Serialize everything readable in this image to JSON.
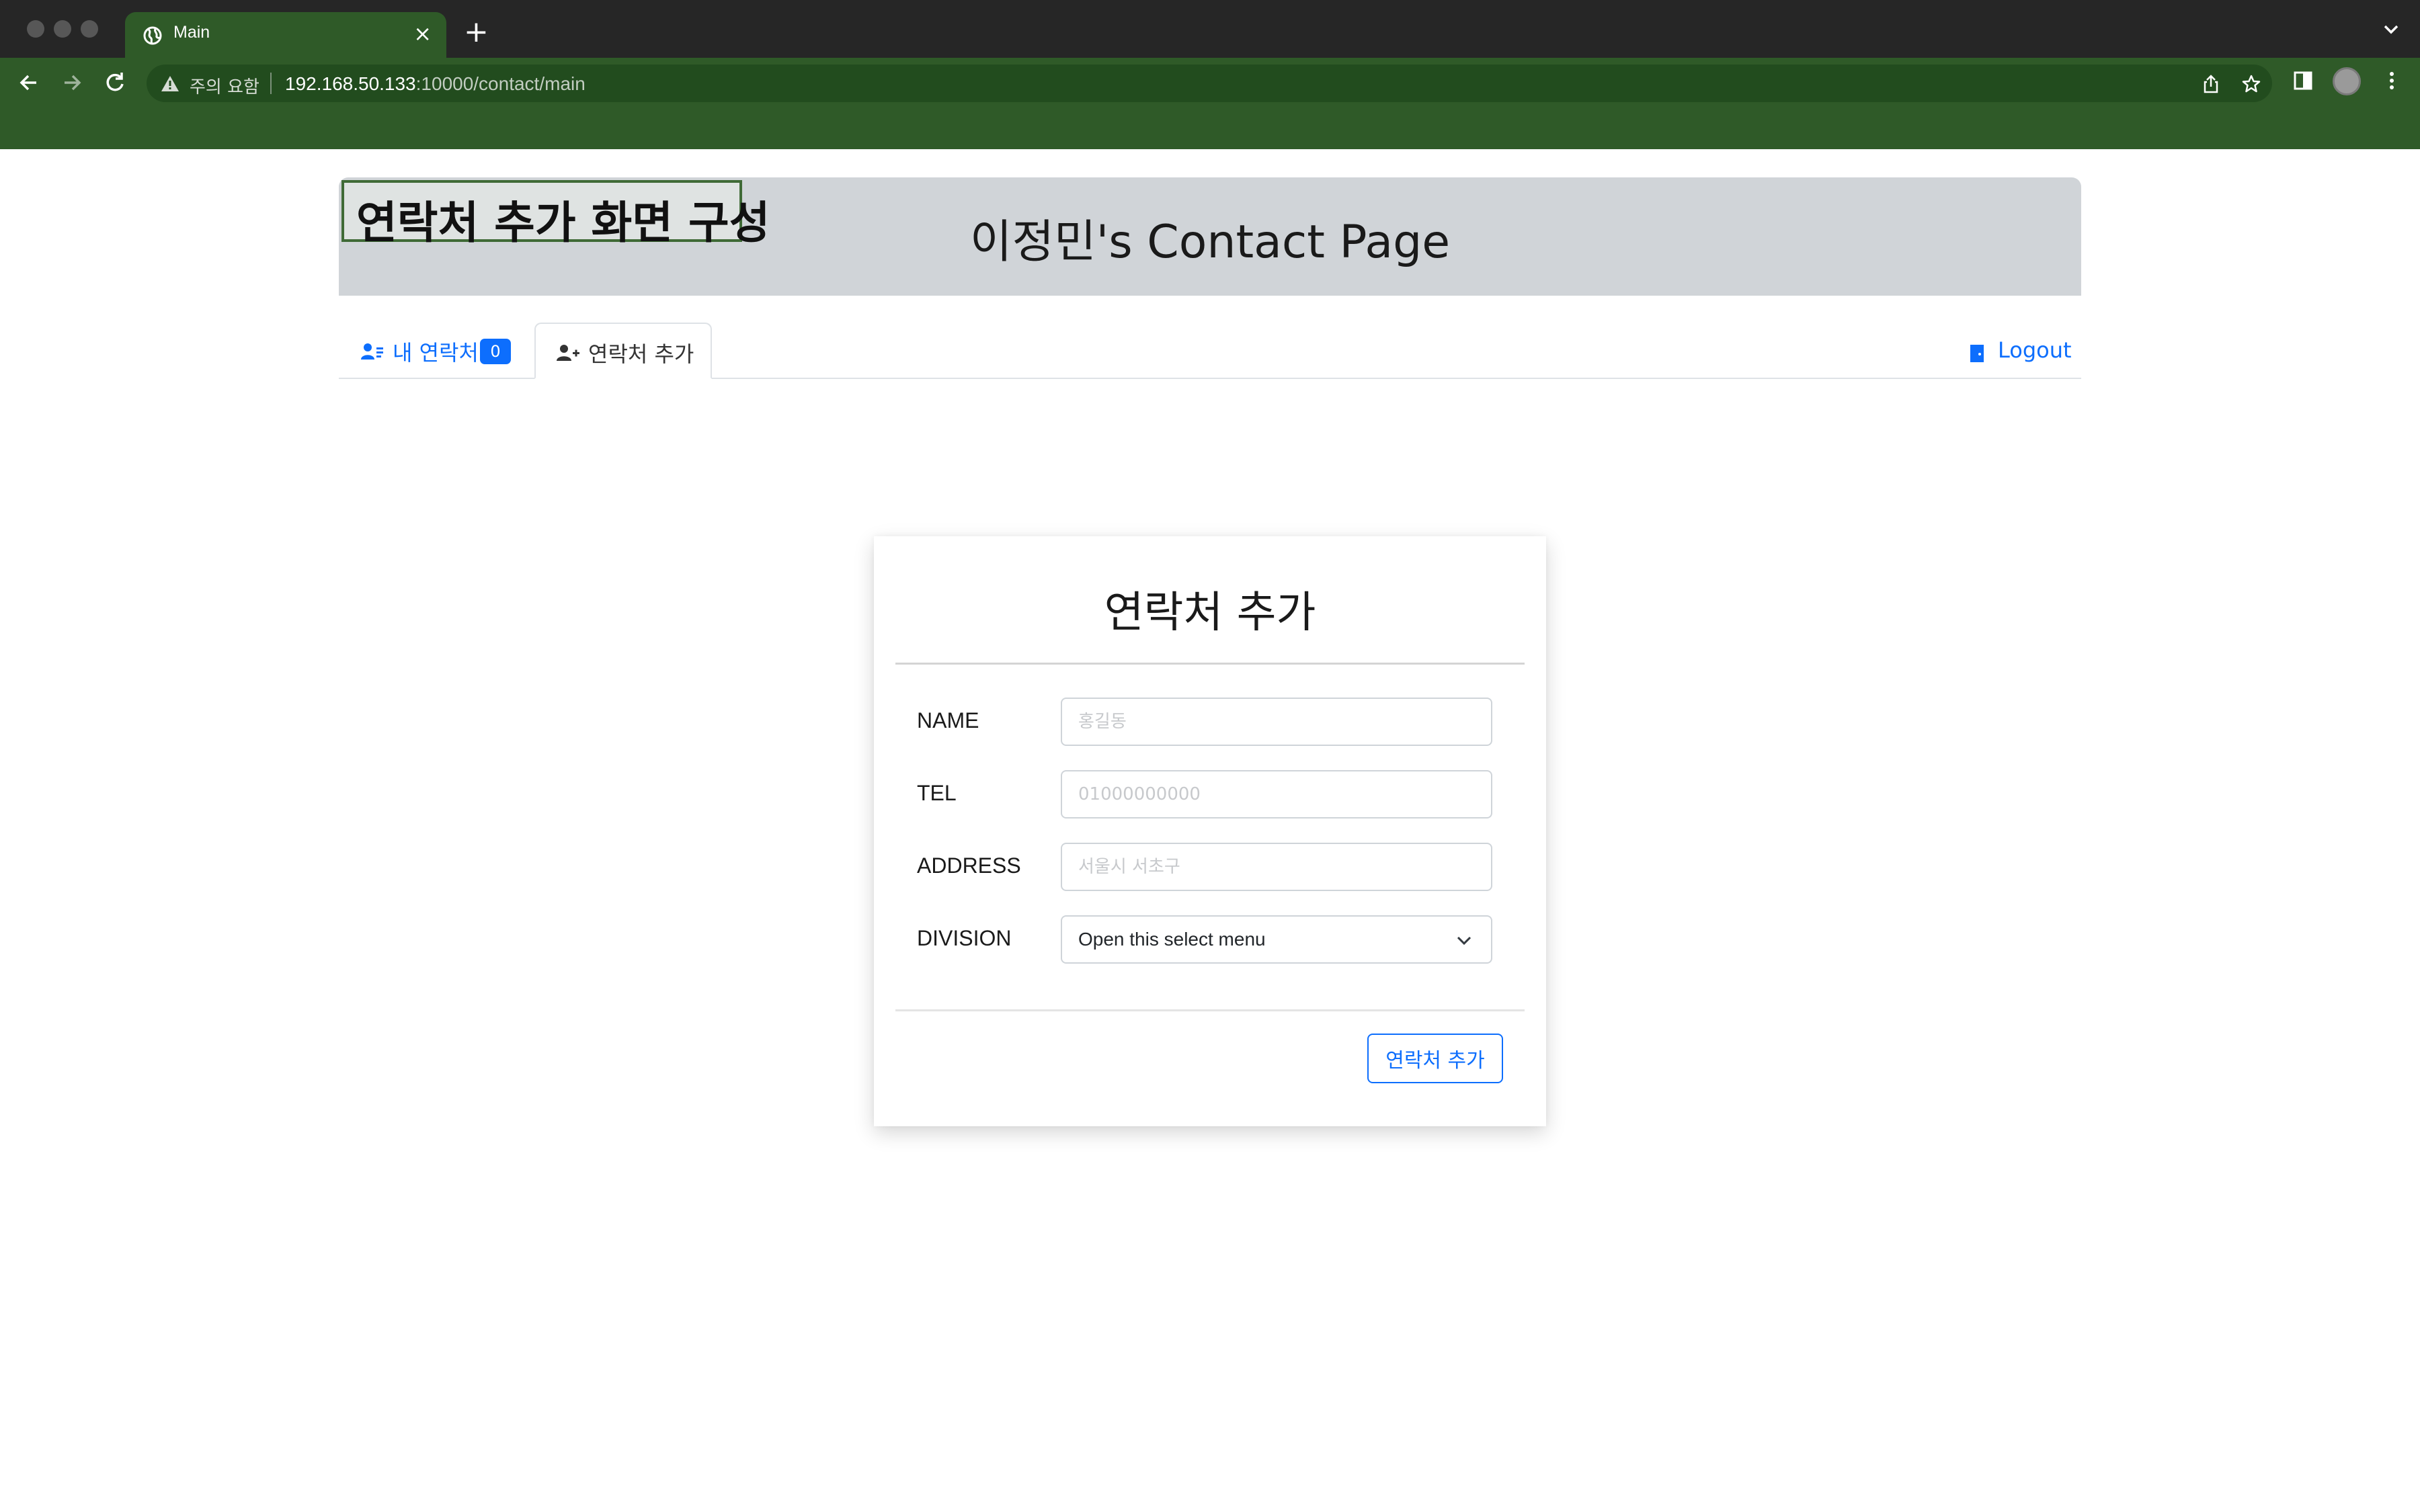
{
  "browser": {
    "tab_title": "Main",
    "tab_close": "×",
    "new_tab": "+",
    "security_label": "주의 요함",
    "url_host": "192.168.50.133",
    "url_rest": ":10000/contact/main",
    "theme_color": "#2f5a28"
  },
  "annotation": {
    "text": "연락처 추가 화면 구성"
  },
  "header": {
    "title": "이정민's Contact Page"
  },
  "nav": {
    "my_contacts_label": "내 연락처",
    "my_contacts_count": "0",
    "add_contact_label": "연락처 추가",
    "logout_label": "Logout",
    "accent_color": "#0d6efd"
  },
  "form": {
    "title": "연락처 추가",
    "fields": {
      "name": {
        "label": "NAME",
        "placeholder": "홍길동"
      },
      "tel": {
        "label": "TEL",
        "placeholder": "01000000000"
      },
      "address": {
        "label": "ADDRESS",
        "placeholder": "서울시 서초구"
      },
      "division": {
        "label": "DIVISION",
        "selected": "Open this select menu"
      }
    },
    "submit_label": "연락처 추가"
  },
  "icons": {
    "tab": "globe-icon",
    "back": "back-arrow-icon",
    "forward": "forward-arrow-icon",
    "reload": "reload-icon",
    "warning": "warning-icon",
    "share": "share-icon",
    "bookmark": "star-icon",
    "side_panel": "side-panel-icon",
    "profile": "profile-avatar-icon",
    "menu": "kebab-menu-icon",
    "my_contacts": "contact-list-icon",
    "add_contact": "add-person-icon",
    "logout": "door-icon",
    "select": "chevron-down-icon"
  }
}
